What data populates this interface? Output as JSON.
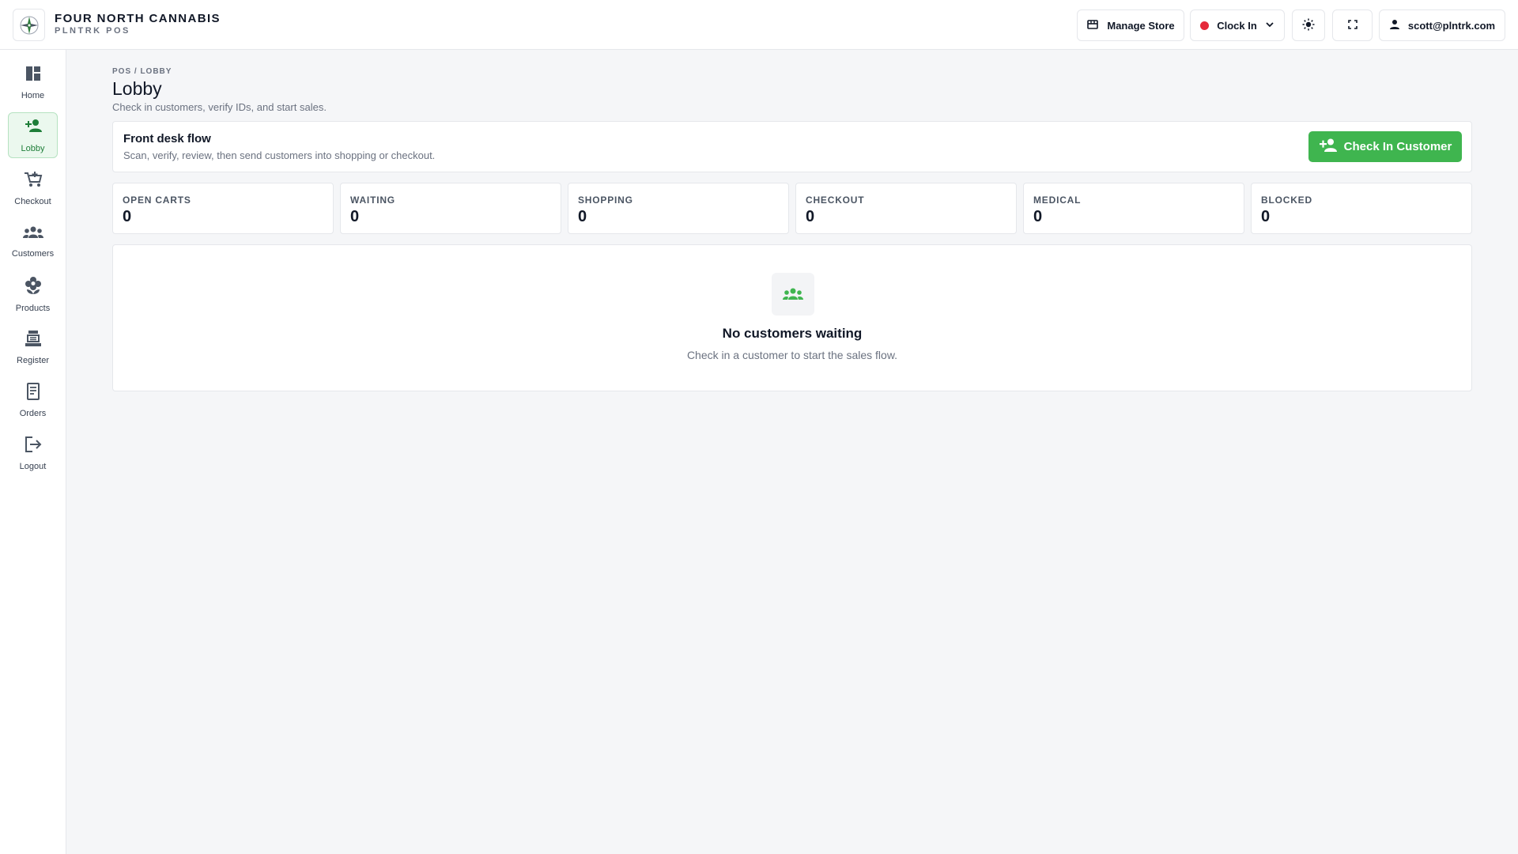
{
  "brand": {
    "name": "FOUR NORTH CANNABIS",
    "sub": "PLNTRK POS"
  },
  "topbar": {
    "manage_store": "Manage Store",
    "clock_in": "Clock In",
    "user_email": "scott@plntrk.com"
  },
  "sidebar": {
    "items": [
      {
        "label": "Home",
        "icon": "dashboard-icon"
      },
      {
        "label": "Lobby",
        "icon": "person-add-icon",
        "active": true
      },
      {
        "label": "Checkout",
        "icon": "cart-icon"
      },
      {
        "label": "Customers",
        "icon": "group-icon"
      },
      {
        "label": "Products",
        "icon": "flower-icon"
      },
      {
        "label": "Register",
        "icon": "register-icon"
      },
      {
        "label": "Orders",
        "icon": "receipt-icon"
      },
      {
        "label": "Logout",
        "icon": "logout-icon"
      }
    ]
  },
  "page": {
    "breadcrumb": "POS / LOBBY",
    "title": "Lobby",
    "subtitle": "Check in customers, verify IDs, and start sales."
  },
  "flow": {
    "title": "Front desk flow",
    "subtitle": "Scan, verify, review, then send customers into shopping or checkout.",
    "button": "Check In Customer"
  },
  "stats": [
    {
      "label": "OPEN CARTS",
      "value": "0"
    },
    {
      "label": "WAITING",
      "value": "0"
    },
    {
      "label": "SHOPPING",
      "value": "0"
    },
    {
      "label": "CHECKOUT",
      "value": "0"
    },
    {
      "label": "MEDICAL",
      "value": "0"
    },
    {
      "label": "BLOCKED",
      "value": "0"
    }
  ],
  "empty": {
    "title": "No customers waiting",
    "subtitle": "Check in a customer to start the sales flow."
  },
  "colors": {
    "accent": "#3fb54f",
    "accent_dark": "#1e7e38",
    "clock_dot": "#e5293a"
  }
}
